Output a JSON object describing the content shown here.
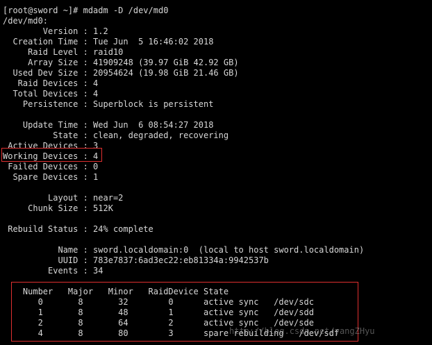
{
  "terminal": {
    "background": "#000000",
    "text_color": "#d8d8d8",
    "highlight_color": "#e03030",
    "lines": [
      "[root@sword ~]# mdadm -D /dev/md0",
      "/dev/md0:",
      "        Version : 1.2",
      "  Creation Time : Tue Jun  5 16:46:02 2018",
      "     Raid Level : raid10",
      "     Array Size : 41909248 (39.97 GiB 42.92 GB)",
      "  Used Dev Size : 20954624 (19.98 GiB 21.46 GB)",
      "   Raid Devices : 4",
      "  Total Devices : 4",
      "    Persistence : Superblock is persistent",
      "",
      "    Update Time : Wed Jun  6 08:54:27 2018",
      "          State : clean, degraded, recovering",
      " Active Devices : 3",
      "Working Devices : 4",
      " Failed Devices : 0",
      "  Spare Devices : 1",
      "",
      "         Layout : near=2",
      "     Chunk Size : 512K",
      "",
      " Rebuild Status : 24% complete",
      "",
      "           Name : sword.localdomain:0  (local to host sword.localdomain)",
      "           UUID : 783e7837:6ad3ec22:eb81334a:9942537b",
      "         Events : 34",
      "",
      "    Number   Major   Minor   RaidDevice State",
      "       0       8       32        0      active sync   /dev/sdc",
      "       1       8       48        1      active sync   /dev/sdd",
      "       2       8       64        2      active sync   /dev/sde",
      "       4       8       80        3      spare rebuilding   /dev/sdf"
    ]
  },
  "watermark": {
    "text": "http://blog.csdn.net/yangZHyu"
  }
}
